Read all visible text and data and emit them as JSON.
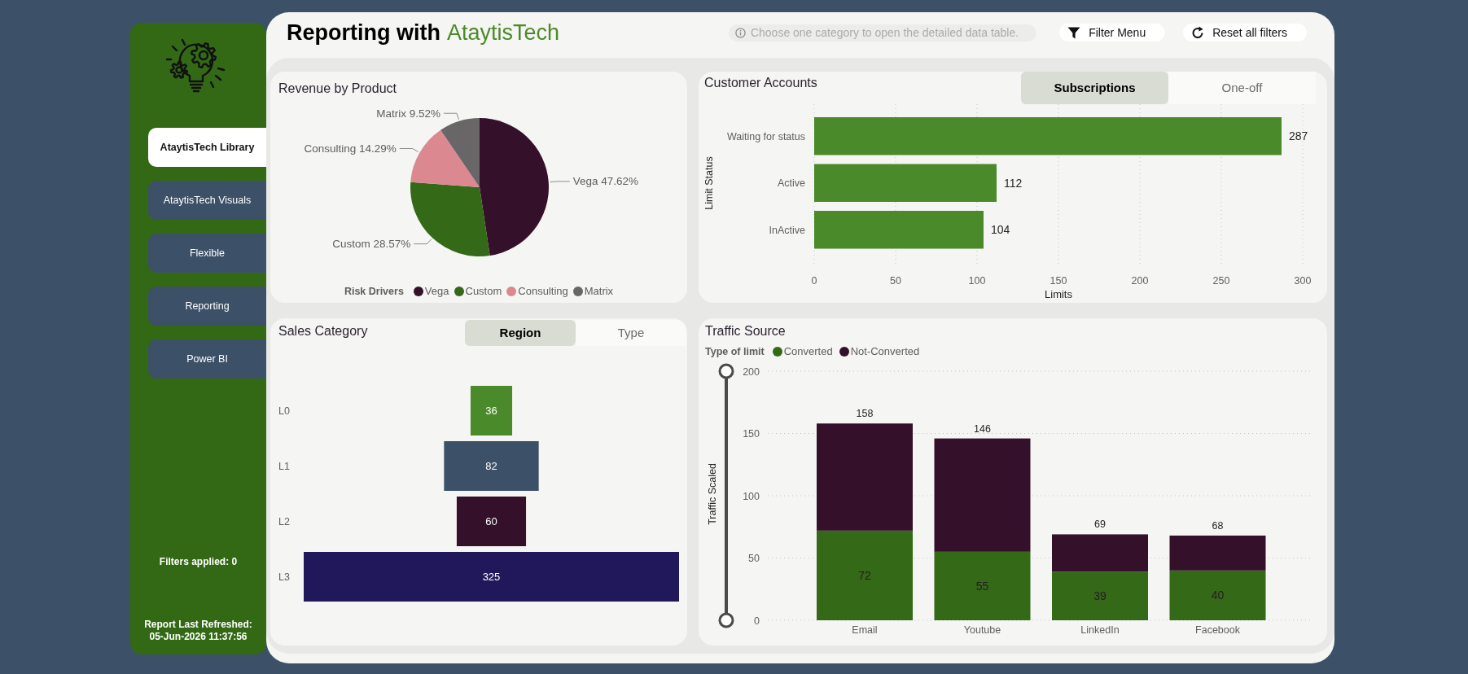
{
  "sidebar": {
    "items": [
      {
        "label": "AtaytisTech Library",
        "selected": true
      },
      {
        "label": "AtaytisTech Visuals",
        "selected": false
      },
      {
        "label": "Flexible",
        "selected": false
      },
      {
        "label": "Reporting",
        "selected": false
      },
      {
        "label": "Power BI",
        "selected": false
      }
    ],
    "filters_applied": "Filters applied: 0",
    "refreshed_label": "Report Last Refreshed:",
    "refreshed_time": "05-Jun-2026 11:37:56"
  },
  "header": {
    "title": "Reporting with",
    "brand": "AtaytisTech",
    "hint": "Choose one category to open the detailed data table.",
    "buttons": [
      {
        "kind": "filter",
        "label": "Filter Menu"
      },
      {
        "kind": "reset",
        "label": "Reset all filters"
      }
    ]
  },
  "revenue": {
    "title": "Revenue by Product",
    "chart_data": {
      "type": "pie",
      "values": [
        47.62,
        28.57,
        14.29,
        9.52
      ],
      "value_labels": [
        "Vega 47.62%",
        "Custom 28.57%",
        "Consulting 14.29%",
        "Matrix 9.52%"
      ]
    },
    "legend": {
      "title": "Risk Drivers",
      "items": [
        {
          "label": "Vega",
          "color": "#34102a"
        },
        {
          "label": "Custom",
          "color": "#336917"
        },
        {
          "label": "Consulting",
          "color": "#dc8891"
        },
        {
          "label": "Matrix",
          "color": "#686666"
        }
      ]
    }
  },
  "accounts": {
    "title": "Customer Accounts",
    "toggle": [
      {
        "label": "Subscriptions",
        "selected": true
      },
      {
        "label": "One-off",
        "selected": false
      }
    ],
    "chart_data": {
      "type": "bar",
      "orientation": "horizontal",
      "xlabel": "Limits",
      "ylabel": "Limit Status",
      "categories": [
        "Waiting for status",
        "Active",
        "InActive"
      ],
      "series": [
        {
          "color": "#4b8a2a",
          "values": [
            287,
            112,
            104
          ]
        }
      ],
      "xlim": [
        0,
        300
      ],
      "xticks": [
        0,
        50,
        100,
        150,
        200,
        250,
        300
      ],
      "grid": true,
      "data_labels": true
    }
  },
  "sales": {
    "title": "Sales Category",
    "toggle": [
      {
        "label": "Region",
        "selected": true
      },
      {
        "label": "Type",
        "selected": false
      }
    ],
    "stages": [
      {
        "label": "L0",
        "value": "36",
        "color": "#4b8a2a"
      },
      {
        "label": "L1",
        "value": "82",
        "color": "#3c5068"
      },
      {
        "label": "L2",
        "value": "60",
        "color": "#34102a"
      },
      {
        "label": "L3",
        "value": "325",
        "color": "#21185c"
      }
    ]
  },
  "traffic": {
    "title": "Traffic Source",
    "legend": {
      "title": "Type of limit"
    },
    "zoom_slider": {
      "level": 1
    },
    "chart_data": {
      "type": "bar",
      "stacked": true,
      "ylabel": "Traffic Scaled",
      "categories": [
        "Email",
        "Youtube",
        "LinkedIn",
        "Facebook"
      ],
      "series": [
        {
          "name": "Converted",
          "color": "#336917",
          "values": [
            72,
            55,
            39,
            40
          ],
          "data_labels": true
        },
        {
          "name": "Not-Converted",
          "color": "#34102a",
          "values": [
            86,
            91,
            30,
            28
          ],
          "data_labels": false
        }
      ],
      "ylim": [
        0,
        200
      ],
      "yticks": [
        0,
        50,
        100,
        150,
        200
      ],
      "grid": true,
      "annotations": [
        {
          "y": 158,
          "text": "158"
        },
        {
          "y": 146,
          "text": "146"
        },
        {
          "y": 69,
          "text": "69"
        },
        {
          "y": 68,
          "text": "68"
        }
      ]
    }
  }
}
